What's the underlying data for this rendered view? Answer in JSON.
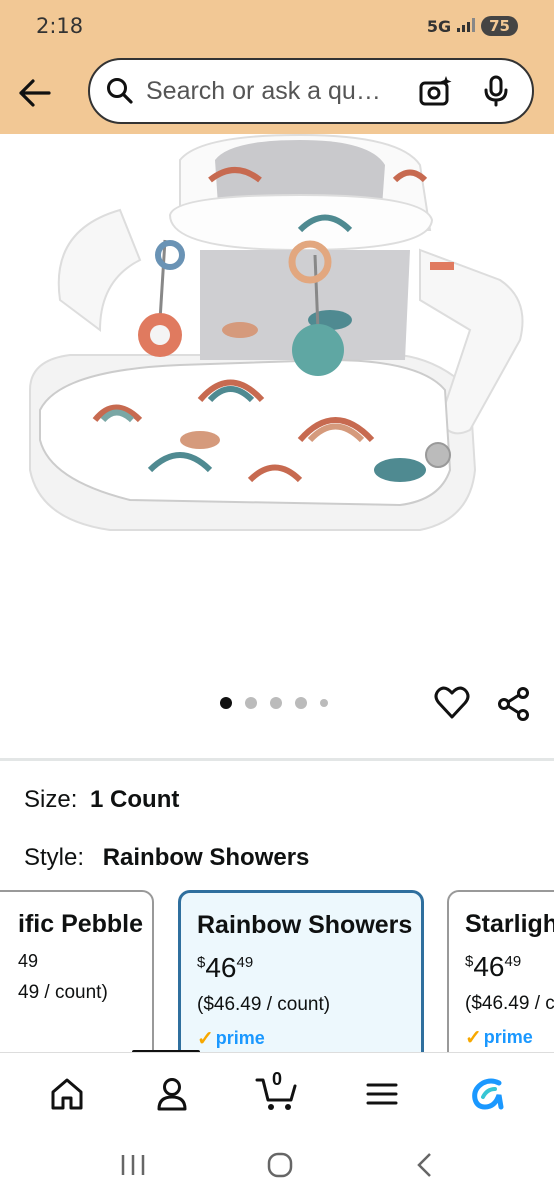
{
  "status": {
    "time": "2:18",
    "network": "5G",
    "battery": "75"
  },
  "header": {
    "search_placeholder": "Search or ask a qu…"
  },
  "gallery": {
    "image_count": 5,
    "active_index": 0,
    "image_alt": "Rainbow Showers baby floor seat"
  },
  "variation": {
    "size_label": "Size:",
    "size_value": "1 Count",
    "style_label": "Style:",
    "style_value": "Rainbow Showers"
  },
  "options": [
    {
      "name": "ific Pebble",
      "price_whole": "",
      "price_frac": "49",
      "unit": "49 / count)",
      "prime": false
    },
    {
      "name": "Rainbow Showers",
      "price_symbol": "$",
      "price_whole": "46",
      "price_frac": "49",
      "unit": "($46.49 / count)",
      "prime": true,
      "prime_label": "prime"
    },
    {
      "name": "Starligh",
      "price_symbol": "$",
      "price_whole": "46",
      "price_frac": "49",
      "unit": "($46.49 / c",
      "prime": true,
      "prime_label": "prime"
    }
  ],
  "bottom_nav": {
    "cart_count": "0"
  },
  "colors": {
    "header_bg": "#f2c895",
    "selected_border": "#2f6f9e",
    "prime_blue": "#1a98ff",
    "prime_check": "#f7a800"
  }
}
